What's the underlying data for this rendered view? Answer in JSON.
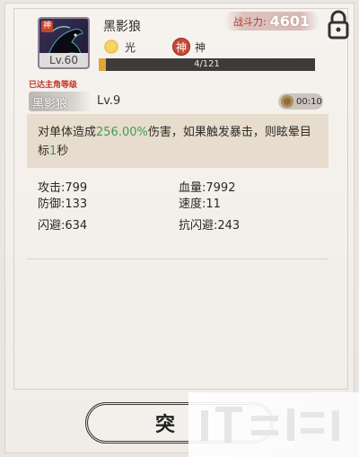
{
  "pet": {
    "name": "黑影狼",
    "level": "Lv.60",
    "portrait_badge": "神",
    "element1": {
      "icon": "sun-icon",
      "label": "光"
    },
    "element2": {
      "icon": "god-emblem-icon",
      "glyph": "神",
      "label": "神"
    }
  },
  "power": {
    "label": "战斗力:",
    "value": "4601"
  },
  "exp": {
    "text": "4/121",
    "progress_fraction": 0.033
  },
  "max_level_note": "已达主角等级",
  "skill": {
    "name": "黑影狼",
    "level": "Lv.9",
    "cooldown": "00:10",
    "desc_part1": "对单体造成",
    "desc_pct": "256.00%",
    "desc_part2": "伤害，如果触发暴击，则眩晕目标",
    "desc_num": "1",
    "desc_part3": "秒"
  },
  "stats": {
    "attack": "攻击:799",
    "hp": "血量:7992",
    "defense": "防御:133",
    "speed": "速度:11",
    "dodge": "闪避:634",
    "anti_dodge": "抗闪避:243"
  },
  "action_button": {
    "label": "突"
  },
  "colors": {
    "accent_red": "#c53328",
    "highlight_green": "#3e9c59",
    "exp_fill": "#e2a33a"
  }
}
